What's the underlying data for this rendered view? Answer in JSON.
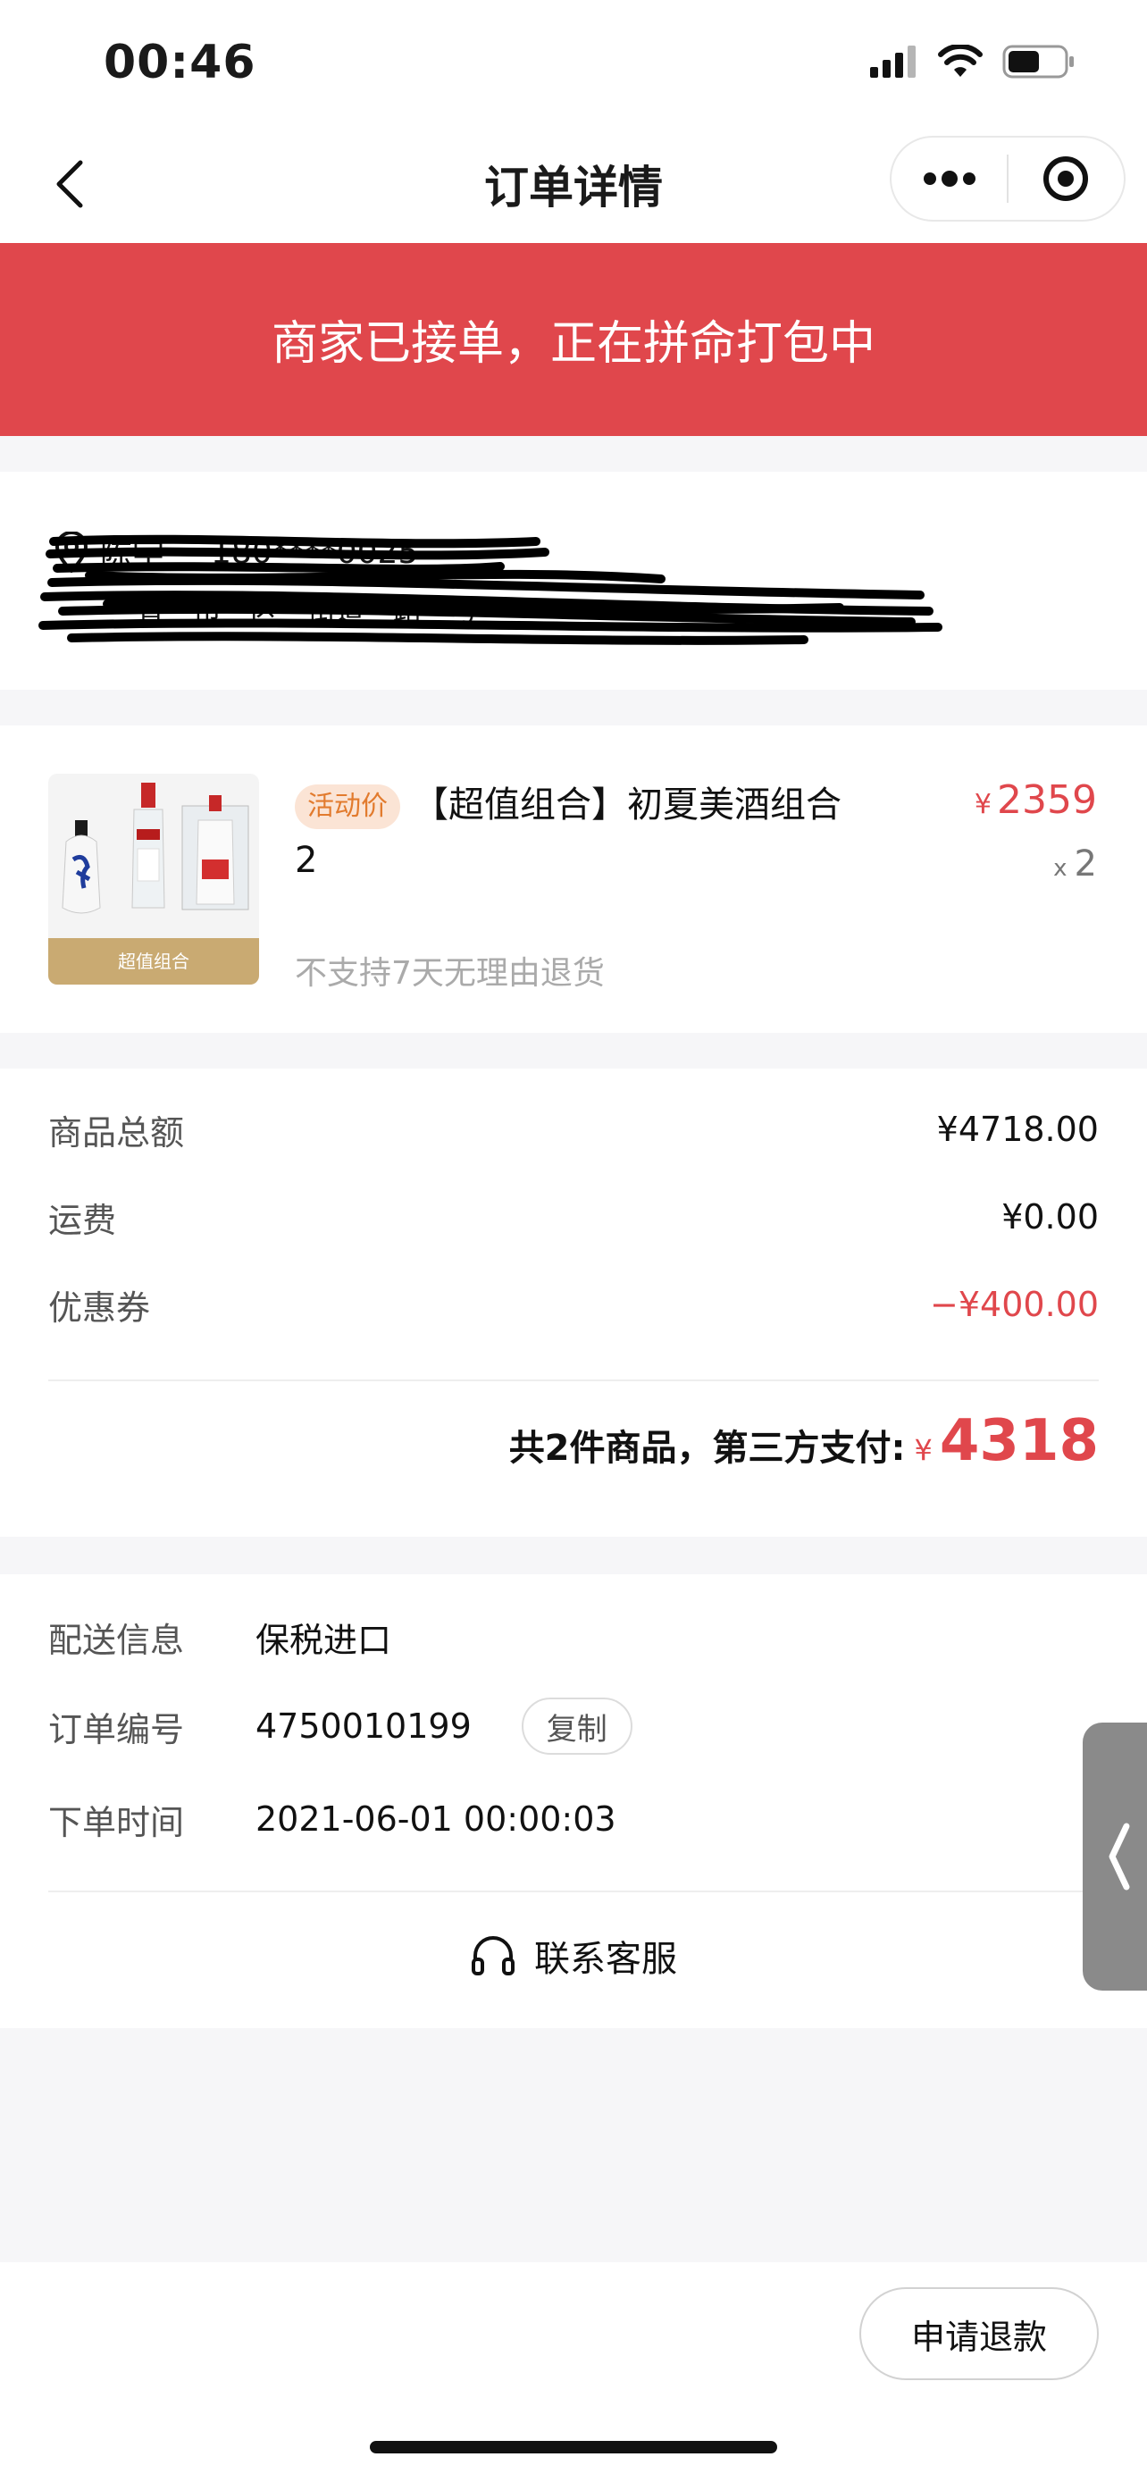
{
  "status_bar": {
    "time": "00:46"
  },
  "nav": {
    "title": "订单详情"
  },
  "banner": {
    "text": "商家已接单，正在拼命打包中"
  },
  "address": {
    "name": "陈宇",
    "phone": "180****0025",
    "detail": "**省**市**区**街道**路**号"
  },
  "product": {
    "promo_tag": "活动价",
    "title": "【超值组合】初夏美酒组合2",
    "image_caption": "超值组合",
    "price_symbol": "¥",
    "price": "2359",
    "qty_symbol": "x",
    "qty": "2",
    "note": "不支持7天无理由退货"
  },
  "totals": {
    "goods_label": "商品总额",
    "goods_value": "¥4718.00",
    "shipping_label": "运费",
    "shipping_value": "¥0.00",
    "coupon_label": "优惠券",
    "coupon_value": "−¥400.00",
    "grand_label": "共2件商品，第三方支付:",
    "grand_yen": "¥",
    "grand_value": "4318"
  },
  "order_info": {
    "delivery_label": "配送信息",
    "delivery_value": "保税进口",
    "order_no_label": "订单编号",
    "order_no_value": "4750010199",
    "copy_label": "复制",
    "time_label": "下单时间",
    "time_value": "2021-06-01 00:00:03",
    "service_label": "联系客服"
  },
  "bottom": {
    "refund_label": "申请退款"
  },
  "colors": {
    "accent_red": "#e0474c",
    "promo_orange": "#e27b2e",
    "promo_bg": "#fbe4d5"
  }
}
